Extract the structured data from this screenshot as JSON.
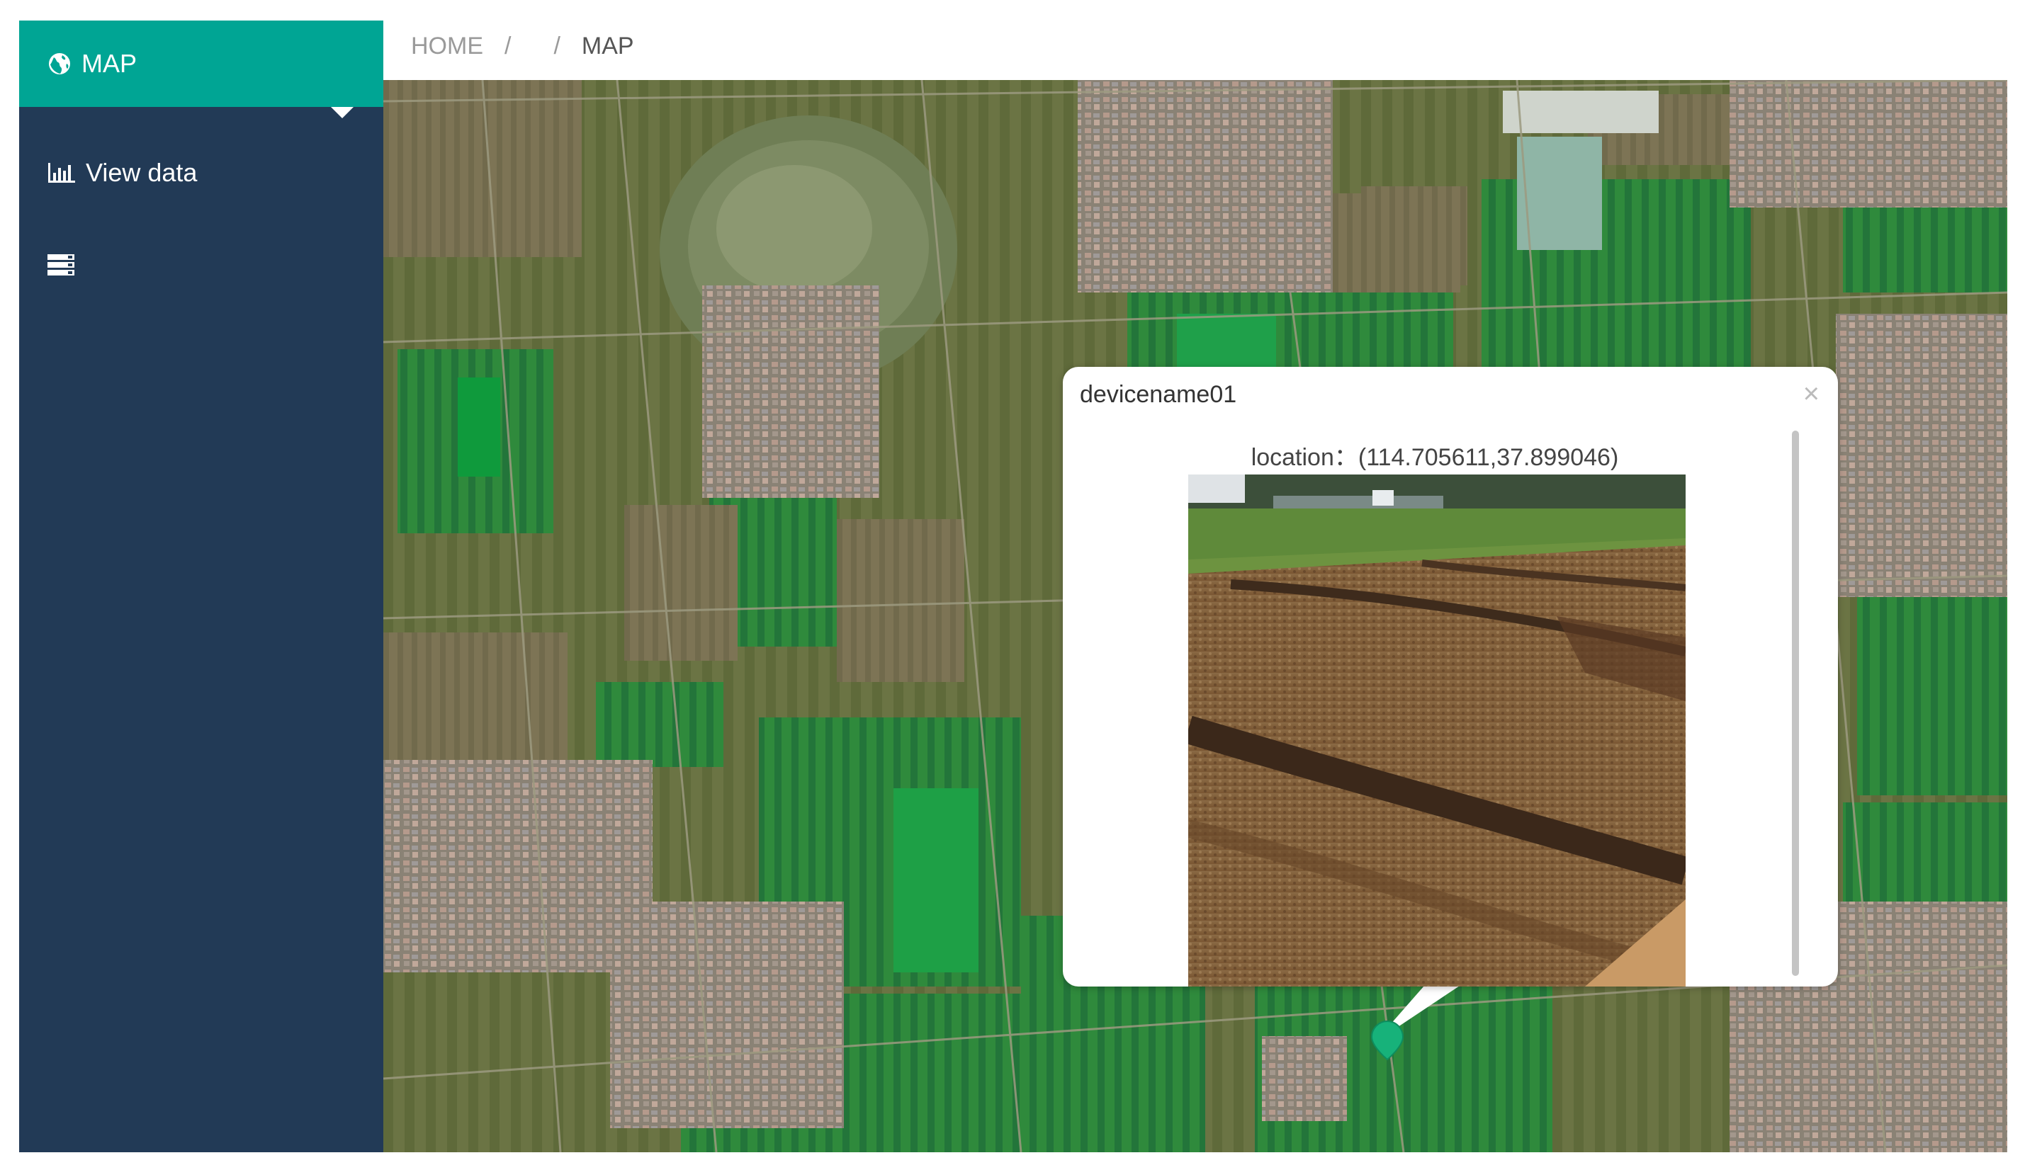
{
  "sidebar": {
    "items": [
      {
        "label": "MAP",
        "icon": "globe-icon",
        "active": true
      },
      {
        "label": "View data",
        "icon": "bar-chart-icon",
        "active": false
      },
      {
        "label": "",
        "icon": "server-icon",
        "active": false
      }
    ]
  },
  "breadcrumb": {
    "home": "HOME",
    "separator": "/",
    "current": "MAP"
  },
  "popup": {
    "title": "devicename01",
    "close_glyph": "×",
    "location_label": "location：",
    "location_value": "(114.705611,37.899046)"
  },
  "colors": {
    "sidebar_bg": "#223a56",
    "active_item_bg": "#00a594",
    "marker": "#17b27a"
  }
}
